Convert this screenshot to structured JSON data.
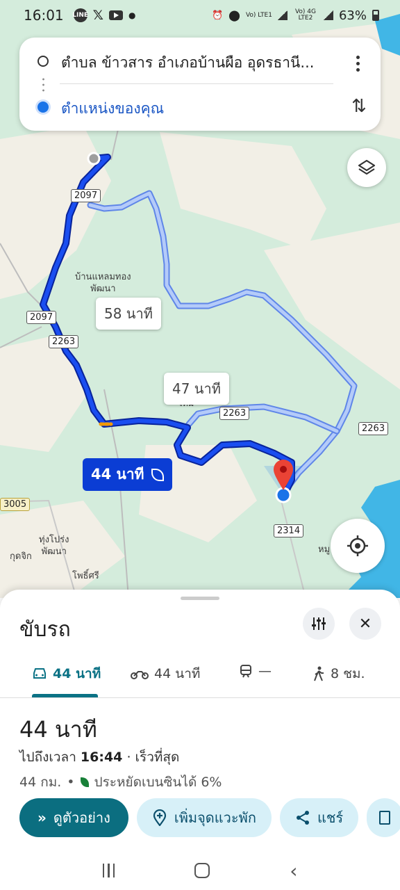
{
  "status_bar": {
    "time": "16:01",
    "left_icons": [
      "line-icon",
      "x-icon",
      "youtube-icon",
      "dot-icon"
    ],
    "right_icons": [
      "2021-icon",
      "location-icon",
      "signal-lte1-icon",
      "signal-lte2-icon"
    ],
    "lte1": "Vo) LTE1",
    "lte2": "Vo) 4G LTE2",
    "battery": "63%"
  },
  "search": {
    "origin": "ตำบล ข้าวสาร อำเภอบ้านผือ อุดรธานี...",
    "destination": "ตำแหน่งของคุณ"
  },
  "map": {
    "road_labels": [
      "2097",
      "2097",
      "2263",
      "2263",
      "2263",
      "3005",
      "2314"
    ],
    "places": [
      "บ้านแหลมทอง\nพัฒนา",
      "ทุ่งโปร่ง\nพัฒนา",
      "กุดจิก",
      "โพธิ์ศรี",
      "หมู",
      "ใหม่"
    ],
    "route_bubbles": {
      "alt1": "58 นาที",
      "alt2": "47 นาที",
      "main": "44 นาที"
    },
    "colors": {
      "primary_route": "#0b3dd4",
      "alt_route": "#a9c2f7",
      "water": "#41b6e6",
      "land": "#d4ecdc"
    }
  },
  "sheet": {
    "title": "ขับรถ",
    "tabs": [
      {
        "icon": "car-icon",
        "label": "44 นาที"
      },
      {
        "icon": "motorcycle-icon",
        "label": "44 นาที"
      },
      {
        "icon": "train-icon",
        "label": "—"
      },
      {
        "icon": "walk-icon",
        "label": "8 ชม."
      }
    ],
    "duration": "44 นาที",
    "arrive_prefix": "ไปถึงเวลา",
    "arrive_time": "16:44",
    "arrive_suffix": "· เร็วที่สุด",
    "distance": "44 กม.",
    "fuel_saving": "ประหยัดเบนซินได้ 6%",
    "actions": {
      "preview": "ดูตัวอย่าง",
      "add_stop": "เพิ่มจุดแวะพัก",
      "share": "แชร์"
    }
  },
  "accent_color": "#0b6e80"
}
